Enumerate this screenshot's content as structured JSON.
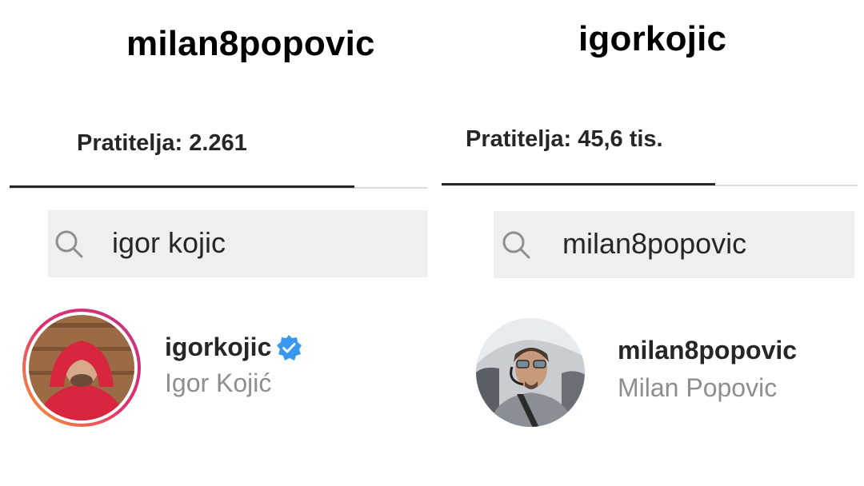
{
  "panels": [
    {
      "profile_username": "milan8popovic",
      "followers_text": "Pratitelja: 2.261",
      "search_query": "igor kojic",
      "result": {
        "username": "igorkojic",
        "full_name": "Igor Kojić",
        "verified": true,
        "story_ring": true,
        "avatar_icon": "avatar-man-red-hoodie"
      }
    },
    {
      "profile_username": "igorkojic",
      "followers_text": "Pratitelja: 45,6 tis.",
      "search_query": "milan8popovic",
      "result": {
        "username": "milan8popovic",
        "full_name": "Milan Popovic",
        "verified": false,
        "story_ring": false,
        "avatar_icon": "avatar-man-cockpit-headset"
      }
    }
  ],
  "colors": {
    "verified_badge": "#3897f0",
    "search_bg": "#efefef",
    "secondary_text": "#8e8e8e",
    "story_ring_start": "#f9a130",
    "story_ring_end": "#c13584"
  },
  "icons": {
    "search": "search-icon",
    "verified": "verified-badge-icon"
  }
}
